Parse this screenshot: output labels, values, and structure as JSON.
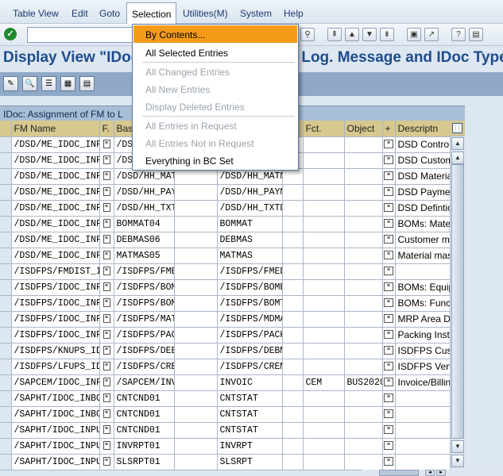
{
  "menu": {
    "items": [
      "Table View",
      "Edit",
      "Goto",
      "Selection",
      "Utilities(M)",
      "System",
      "Help"
    ]
  },
  "title": "Display View \"IDoc: Assignment of FM to Log. Message and IDoc Type\"",
  "table_caption": "IDoc: Assignment of FM to L",
  "columns": [
    "FM Name",
    "F.",
    "Bas",
    "",
    "",
    "Fct.",
    "Object",
    "+",
    "Descriptn"
  ],
  "rows": [
    {
      "fm": "/DSD/ME_IDOC_INF",
      "basic": "/DSD",
      "msg": "",
      "fct": "",
      "object": "",
      "desc": "DSD Control Out"
    },
    {
      "fm": "/DSD/ME_IDOC_INF",
      "basic": "/DSD",
      "msg": "",
      "fct": "",
      "object": "",
      "desc": "DSD Customer M"
    },
    {
      "fm": "/DSD/ME_IDOC_INF",
      "basic": "/DSD/HH_MAT",
      "msg": "/DSD/HH_MATN",
      "fct": "",
      "object": "",
      "desc": "DSD Material Ma"
    },
    {
      "fm": "/DSD/ME_IDOC_INF",
      "basic": "/DSD/HH_PAY",
      "msg": "/DSD/HH_PAYN",
      "fct": "",
      "object": "",
      "desc": "DSD Payment Te"
    },
    {
      "fm": "/DSD/ME_IDOC_INF",
      "basic": "/DSD/HH_TXT",
      "msg": "/DSD/HH_TXTD",
      "fct": "",
      "object": "",
      "desc": "DSD Defintions o"
    },
    {
      "fm": "/DSD/ME_IDOC_INF",
      "basic": "BOMMAT04",
      "msg": "BOMMAT",
      "fct": "",
      "object": "",
      "desc": "BOMs: Material E"
    },
    {
      "fm": "/DSD/ME_IDOC_INF",
      "basic": "DEBMAS06",
      "msg": "DEBMAS",
      "fct": "",
      "object": "",
      "desc": "Customer maste"
    },
    {
      "fm": "/DSD/ME_IDOC_INF",
      "basic": "MATMAS05",
      "msg": "MATMAS",
      "fct": "",
      "object": "",
      "desc": "Material master"
    },
    {
      "fm": "/ISDFPS/FMDIST_I",
      "basic": "/ISDFPS/FME",
      "msg": "/ISDFPS/FMED",
      "fct": "",
      "object": "",
      "desc": ""
    },
    {
      "fm": "/ISDFPS/IDOC_INF",
      "basic": "/ISDFPS/BOM",
      "msg": "/ISDFPS/BOME",
      "fct": "",
      "object": "",
      "desc": "BOMs: Equipme"
    },
    {
      "fm": "/ISDFPS/IDOC_INF",
      "basic": "/ISDFPS/BOM",
      "msg": "/ISDFPS/BOMT",
      "fct": "",
      "object": "",
      "desc": "BOMs: Functiona"
    },
    {
      "fm": "/ISDFPS/IDOC_INF",
      "basic": "/ISDFPS/MAT",
      "msg": "/ISDFPS/MDMA",
      "fct": "",
      "object": "",
      "desc": "MRP Area Data M"
    },
    {
      "fm": "/ISDFPS/IDOC_INF",
      "basic": "/ISDFPS/PAC",
      "msg": "/ISDFPS/PACK",
      "fct": "",
      "object": "",
      "desc": "Packing Instructi"
    },
    {
      "fm": "/ISDFPS/KNUPS_ID",
      "basic": "/ISDFPS/DEE",
      "msg": "/ISDFPS/DEBM",
      "fct": "",
      "object": "",
      "desc": "ISDFPS Custom"
    },
    {
      "fm": "/ISDFPS/LFUPS_ID",
      "basic": "/ISDFPS/CRE",
      "msg": "/ISDFPS/CREM",
      "fct": "",
      "object": "",
      "desc": "ISDFPS Vendor I"
    },
    {
      "fm": "/SAPCEM/IDOC_INF",
      "basic": "/SAPCEM/INV",
      "msg": "INVOIC",
      "fct": "CEM",
      "object": "BUS2020",
      "desc": "Invoice/Billing Do"
    },
    {
      "fm": "/SAPHT/IDOC_INBO",
      "basic": "CNTCND01",
      "msg": "CNTSTAT",
      "fct": "",
      "object": "",
      "desc": ""
    },
    {
      "fm": "/SAPHT/IDOC_INBO",
      "basic": "CNTCND01",
      "msg": "CNTSTAT",
      "fct": "",
      "object": "",
      "desc": ""
    },
    {
      "fm": "/SAPHT/IDOC_INPU",
      "basic": "CNTCND01",
      "msg": "CNTSTAT",
      "fct": "",
      "object": "",
      "desc": ""
    },
    {
      "fm": "/SAPHT/IDOC_INPU",
      "basic": "INVRPT01",
      "msg": "INVRPT",
      "fct": "",
      "object": "",
      "desc": ""
    },
    {
      "fm": "/SAPHT/IDOC_INPU",
      "basic": "SLSRPT01",
      "msg": "SLSRPT",
      "fct": "",
      "object": "",
      "desc": ""
    }
  ],
  "dropdown": {
    "items": [
      {
        "label": "By Contents...",
        "enabled": true,
        "highlighted": true
      },
      {
        "label": "All Selected Entries",
        "enabled": true
      },
      {
        "label": "All Changed Entries",
        "enabled": false
      },
      {
        "label": "All New Entries",
        "enabled": false
      },
      {
        "label": "Display Deleted Entries",
        "enabled": false
      },
      {
        "label": "All Entries in Request",
        "enabled": false
      },
      {
        "label": "All Entries Not in Request",
        "enabled": false
      },
      {
        "label": "Everything in BC Set",
        "enabled": true
      }
    ]
  },
  "colors": {
    "title": "#1f4c8c",
    "highlight": "#f49b1a",
    "header_bg": "#d6c88e",
    "app_toolbar": "#8fa9c7"
  }
}
